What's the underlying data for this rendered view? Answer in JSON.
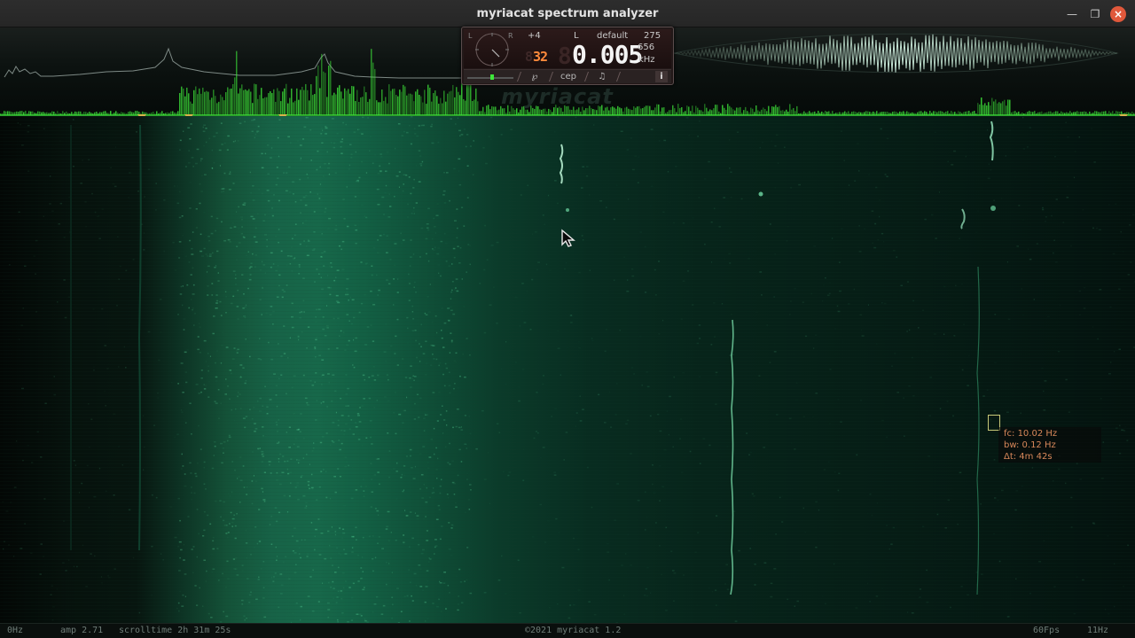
{
  "window": {
    "title": "myriacat spectrum analyzer",
    "controls": [
      "minimize-icon",
      "maximize-icon",
      "close-icon"
    ]
  },
  "widget": {
    "offset": "+4",
    "channel": "L",
    "preset": "default",
    "bin_size": "275",
    "bits": "32",
    "frequency": "0.005",
    "multiplier": "656",
    "unit": "kHz",
    "buttons": {
      "tuner_icon": "tuning-fork-icon",
      "cep": "cep",
      "note_icon": "music-note-icon",
      "info": "i"
    }
  },
  "watermark": "myriacat",
  "readout": {
    "fc": "fc: 10.02 Hz",
    "bw": "bw: 0.12 Hz",
    "dt": "Δt: 4m 42s"
  },
  "status": {
    "left_freq": "0Hz",
    "amp": "amp 2.71",
    "scrolltime": "scrolltime 2h 31m 25s",
    "copyright": "©2021 myriacat 1.2",
    "fps": "60Fps",
    "right_freq": "11Hz"
  },
  "colors": {
    "spectrum_green": "#3ee63a",
    "readout_orange": "#d8885a",
    "frequency_digits": "#f4f4f4",
    "bits_digits": "#ff8a3c",
    "close_button": "#e0583b"
  }
}
